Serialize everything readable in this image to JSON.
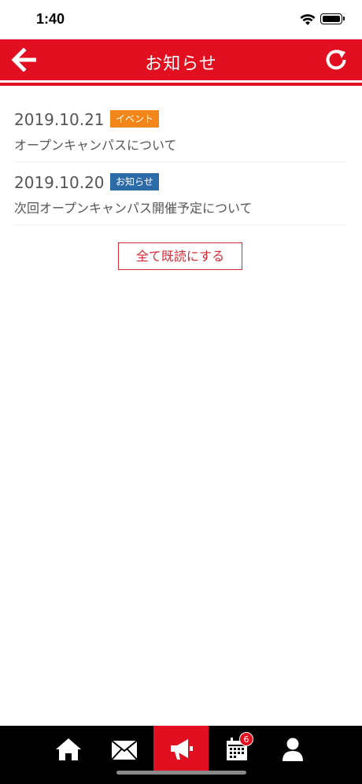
{
  "status_bar": {
    "time": "1:40"
  },
  "header": {
    "title": "お知らせ"
  },
  "news": [
    {
      "date": "2019.10.21",
      "tag": "イベント",
      "tag_color": "#f3861b",
      "title": "オープンキャンパスについて"
    },
    {
      "date": "2019.10.20",
      "tag": "お知らせ",
      "tag_color": "#2c6aa8",
      "title": "次回オープンキャンパス開催予定について"
    }
  ],
  "actions": {
    "mark_all_read": "全て既読にする"
  },
  "tab_bar": {
    "tabs": [
      {
        "icon": "home-icon"
      },
      {
        "icon": "mail-icon"
      },
      {
        "icon": "megaphone-icon",
        "active": true
      },
      {
        "icon": "calendar-icon",
        "badge": "6"
      },
      {
        "icon": "user-icon"
      }
    ]
  },
  "colors": {
    "brand": "#e10f1f",
    "event_tag": "#f3861b",
    "info_tag": "#2c6aa8"
  }
}
